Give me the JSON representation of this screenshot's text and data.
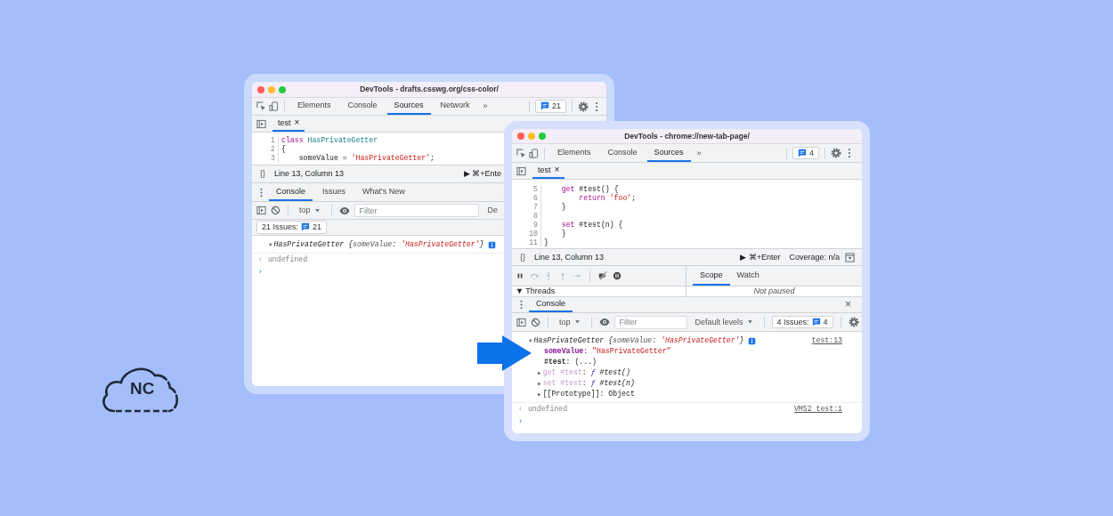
{
  "windows": [
    {
      "title": "DevTools - drafts.csswg.org/css-color/",
      "tabs": [
        {
          "label": "Elements",
          "selected": false
        },
        {
          "label": "Console",
          "selected": false
        },
        {
          "label": "Sources",
          "selected": true
        },
        {
          "label": "Network",
          "selected": false
        }
      ],
      "overflow": "»",
      "issues_badge": "21",
      "file_tab": {
        "label": "test",
        "close": "×"
      },
      "code": [
        {
          "number": "1",
          "tokens": [
            {
              "kind": "keyword",
              "text": "class"
            },
            {
              "kind": "def",
              "text": " HasPrivateGetter"
            }
          ]
        },
        {
          "number": "2",
          "tokens": [
            {
              "kind": "plain",
              "text": "{"
            }
          ]
        },
        {
          "number": "3",
          "tokens": [
            {
              "kind": "plain",
              "text": "    someValue = "
            },
            {
              "kind": "string",
              "text": "'HasPrivateGetter'"
            },
            {
              "kind": "plain",
              "text": ";"
            }
          ]
        }
      ],
      "status": {
        "format": "{}",
        "position": "Line 13, Column 13",
        "run": "▶ ⌘+Ente"
      },
      "drawer": {
        "tabs": [
          {
            "label": "Console",
            "selected": true
          },
          {
            "label": "Issues",
            "selected": false
          },
          {
            "label": "What's New",
            "selected": false
          }
        ]
      },
      "console_toolbar": {
        "context": "top",
        "filter_placeholder": "Filter",
        "levels": {
          "label": "De",
          "dropdown": false
        }
      },
      "issues": {
        "kind": "bar",
        "label": "21 Issues:",
        "count": "21"
      },
      "output": [
        {
          "kind": "object",
          "toggle": "▼",
          "tokens": [
            {
              "kind": "class",
              "text": "HasPrivateGetter"
            },
            {
              "kind": "punct",
              "text": " {"
            },
            {
              "kind": "key",
              "text": "someValue"
            },
            {
              "kind": "punct",
              "text": ": "
            },
            {
              "kind": "string",
              "text": "'HasPrivateGetter'"
            },
            {
              "kind": "punct",
              "text": "}"
            }
          ],
          "info": true
        },
        {
          "kind": "result",
          "marker": "‹",
          "tokens": [
            {
              "kind": "muted",
              "text": "undefined"
            }
          ]
        },
        {
          "kind": "prompt",
          "marker": "›"
        }
      ]
    },
    {
      "title": "DevTools - chrome://new-tab-page/",
      "tabs": [
        {
          "label": "Elements",
          "selected": false
        },
        {
          "label": "Console",
          "selected": false
        },
        {
          "label": "Sources",
          "selected": true
        }
      ],
      "overflow": "»",
      "issues_badge": "4",
      "file_tab": {
        "label": "test",
        "close": "×"
      },
      "code": [
        {
          "number": "5",
          "tokens": [
            {
              "kind": "keyword",
              "text": "    get"
            },
            {
              "kind": "plain",
              "text": " #test() {"
            }
          ]
        },
        {
          "number": "6",
          "tokens": [
            {
              "kind": "keyword",
              "text": "        return"
            },
            {
              "kind": "string",
              "text": " 'foo'"
            },
            {
              "kind": "plain",
              "text": ";"
            }
          ]
        },
        {
          "number": "7",
          "tokens": [
            {
              "kind": "plain",
              "text": "    }"
            }
          ]
        },
        {
          "number": "8"
        },
        {
          "number": "9",
          "tokens": [
            {
              "kind": "keyword",
              "text": "    set"
            },
            {
              "kind": "plain",
              "text": " #test(n) {"
            }
          ]
        },
        {
          "number": "10",
          "tokens": [
            {
              "kind": "plain",
              "text": "    }"
            }
          ]
        },
        {
          "number": "11",
          "tokens": [
            {
              "kind": "plain",
              "text": "}"
            }
          ]
        }
      ],
      "status": {
        "format": "{}",
        "position": "Line 13, Column 13",
        "run": "▶ ⌘+Enter",
        "coverage": "Coverage: n/a"
      },
      "debugger": {
        "buttons": [
          {
            "kind": "pause",
            "disabled": false
          },
          {
            "kind": "step-over",
            "disabled": true
          },
          {
            "kind": "step-into",
            "disabled": true
          },
          {
            "kind": "step-out",
            "disabled": true
          },
          {
            "kind": "step",
            "disabled": true
          },
          {
            "kind": "deactivate",
            "disabled": false
          },
          {
            "kind": "pause-exceptions",
            "disabled": false
          }
        ],
        "tabs": [
          {
            "label": "Scope",
            "selected": true
          },
          {
            "label": "Watch",
            "selected": false
          }
        ],
        "threads": {
          "toggle": "▼",
          "label": "Threads"
        },
        "message": "Not paused"
      },
      "drawer": {
        "tabs": [
          {
            "label": "Console",
            "selected": true
          }
        ],
        "close": "×"
      },
      "console_toolbar": {
        "context": "top",
        "filter_placeholder": "Filter",
        "levels": {
          "label": "Default levels",
          "dropdown": true
        }
      },
      "issues": {
        "kind": "toolbar",
        "label": "4 Issues:",
        "count": "4"
      },
      "output": [
        {
          "kind": "object",
          "toggle": "▼",
          "tokens": [
            {
              "kind": "class",
              "text": "HasPrivateGetter"
            },
            {
              "kind": "punct",
              "text": " {"
            },
            {
              "kind": "key",
              "text": "someValue"
            },
            {
              "kind": "punct",
              "text": ": "
            },
            {
              "kind": "string",
              "text": "'HasPrivateGetter'"
            },
            {
              "kind": "punct",
              "text": "}"
            }
          ],
          "info": true,
          "source": "test:13",
          "children": [
            {
              "kind": "property",
              "tokens": [
                {
                  "kind": "prop",
                  "text": "someValue"
                },
                {
                  "kind": "plain",
                  "text": ": "
                },
                {
                  "kind": "dstring",
                  "text": "\"HasPrivateGetter\""
                }
              ]
            },
            {
              "kind": "property",
              "tokens": [
                {
                  "kind": "private",
                  "text": "#test"
                },
                {
                  "kind": "plain",
                  "text": ": (...)"
                }
              ]
            },
            {
              "kind": "property",
              "toggle": "▶",
              "tokens": [
                {
                  "kind": "dim",
                  "text": "get #test"
                },
                {
                  "kind": "plain",
                  "text": ": "
                },
                {
                  "kind": "fn",
                  "text": "ƒ"
                },
                {
                  "kind": "fnname",
                  "text": " #test()"
                }
              ]
            },
            {
              "kind": "property",
              "toggle": "▶",
              "tokens": [
                {
                  "kind": "dim",
                  "text": "set #test"
                },
                {
                  "kind": "plain",
                  "text": ": "
                },
                {
                  "kind": "fn",
                  "text": "ƒ"
                },
                {
                  "kind": "fnname",
                  "text": " #test(n)"
                }
              ]
            },
            {
              "kind": "property",
              "toggle": "▶",
              "tokens": [
                {
                  "kind": "plain",
                  "text": "[[Prototype]]: Object"
                }
              ]
            }
          ]
        },
        {
          "kind": "result",
          "marker": "‹",
          "tokens": [
            {
              "kind": "muted",
              "text": "undefined"
            }
          ],
          "source": "VM52 test:1"
        },
        {
          "kind": "prompt",
          "marker": "›"
        }
      ]
    }
  ],
  "logo": {
    "text": "NC"
  }
}
